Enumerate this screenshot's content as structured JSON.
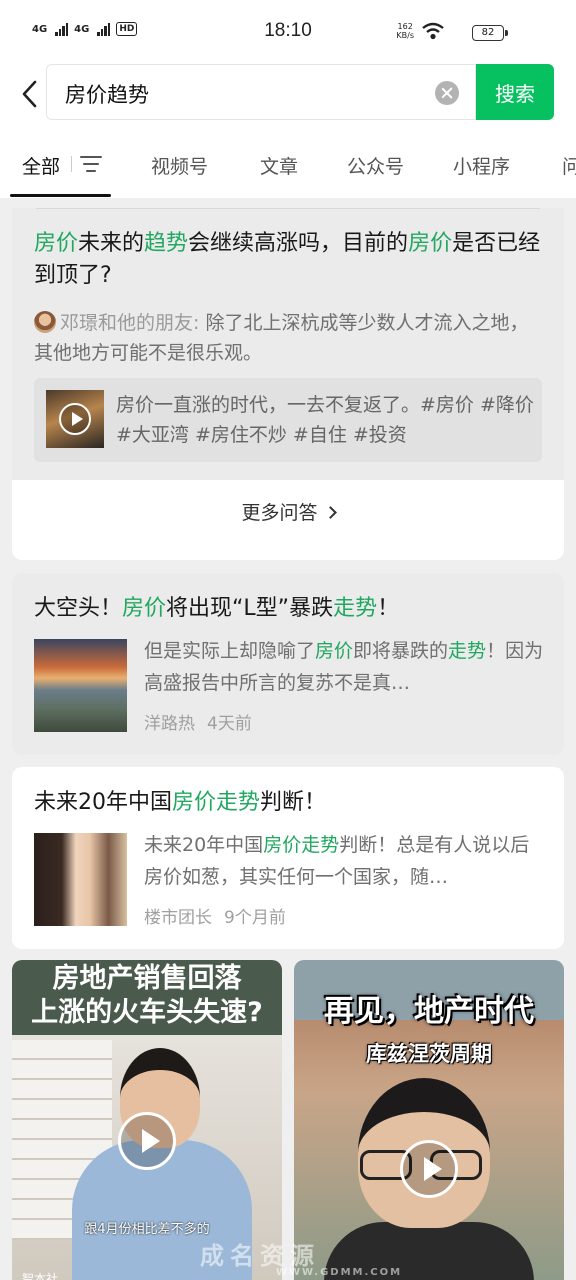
{
  "status_bar": {
    "net1": "4G",
    "net2": "4G",
    "hd": "HD",
    "time": "18:10",
    "speed_value": "162",
    "speed_unit": "KB/s",
    "battery": "82"
  },
  "search": {
    "query": "房价趋势",
    "button_label": "搜索"
  },
  "tabs": [
    {
      "label": "全部",
      "active": true
    },
    {
      "label": "视频号"
    },
    {
      "label": "文章"
    },
    {
      "label": "公众号"
    },
    {
      "label": "小程序"
    },
    {
      "label": "问"
    }
  ],
  "qa_card": {
    "title_parts": [
      "房价",
      "未来的",
      "趋势",
      "会继续高涨吗，目前的",
      "房价",
      "是否已经到顶了?"
    ],
    "answerer": "邓璟和他的朋友:",
    "answer": "除了北上深杭成等少数人才流入之地，其他地方可能不是很乐观。",
    "video_text": "房价一直涨的时代，一去不复返了。#房价 #降价 #大亚湾 #房住不炒 #自住 #投资",
    "more_label": "更多问答"
  },
  "articles": [
    {
      "title_parts": [
        "大空头！",
        "房价",
        "将出现“L型”暴跌",
        "走势",
        "！"
      ],
      "snippet_parts": [
        "但是实际上却隐喻了",
        "房价",
        "即将暴跌的",
        "走势",
        "！因为高盛报告中所言的复苏不是真…"
      ],
      "source": "洋路热",
      "time": "4天前"
    },
    {
      "title_parts": [
        "未来20年中国",
        "房价走势",
        "判断！"
      ],
      "snippet_parts": [
        "未来20年中国",
        "房价走势",
        "判断！总是有人说以后房价如葱，其实任何一个国家，随…"
      ],
      "source": "楼市团长",
      "time": "9个月前"
    }
  ],
  "videos": [
    {
      "caption_line1": "房地产销售回落",
      "caption_line2": "上涨的火车头失速?",
      "subtitle": "跟4月份相比差不多的",
      "source": "智本社"
    },
    {
      "caption_line1": "再见，地产时代",
      "caption_line2": "库兹涅茨周期"
    }
  ],
  "watermark": {
    "text": "成名资源",
    "url": "WWW.GDMM.COM"
  },
  "colors": {
    "accent": "#07c160",
    "highlight": "#20a860"
  }
}
